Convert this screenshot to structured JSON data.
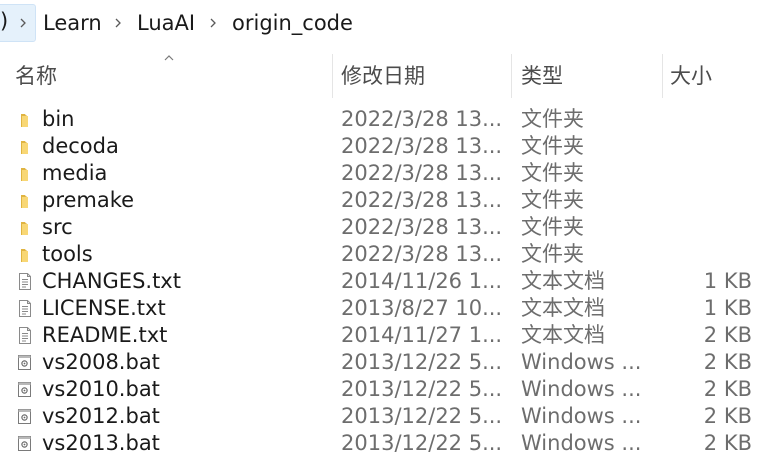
{
  "breadcrumb": {
    "partial_left": ")",
    "items": [
      "Learn",
      "LuaAI",
      "origin_code"
    ]
  },
  "columns": {
    "name": "名称",
    "date": "修改日期",
    "type": "类型",
    "size": "大小"
  },
  "files": [
    {
      "name": "bin",
      "date": "2022/3/28 13...",
      "type": "文件夹",
      "size": "",
      "icon": "folder-icon"
    },
    {
      "name": "decoda",
      "date": "2022/3/28 13...",
      "type": "文件夹",
      "size": "",
      "icon": "folder-icon"
    },
    {
      "name": "media",
      "date": "2022/3/28 13...",
      "type": "文件夹",
      "size": "",
      "icon": "folder-icon"
    },
    {
      "name": "premake",
      "date": "2022/3/28 13...",
      "type": "文件夹",
      "size": "",
      "icon": "folder-icon"
    },
    {
      "name": "src",
      "date": "2022/3/28 13...",
      "type": "文件夹",
      "size": "",
      "icon": "folder-icon"
    },
    {
      "name": "tools",
      "date": "2022/3/28 13...",
      "type": "文件夹",
      "size": "",
      "icon": "folder-icon"
    },
    {
      "name": "CHANGES.txt",
      "date": "2014/11/26 1...",
      "type": "文本文档",
      "size": "1 KB",
      "icon": "text-file-icon"
    },
    {
      "name": "LICENSE.txt",
      "date": "2013/8/27 10...",
      "type": "文本文档",
      "size": "1 KB",
      "icon": "text-file-icon"
    },
    {
      "name": "README.txt",
      "date": "2014/11/27 1...",
      "type": "文本文档",
      "size": "2 KB",
      "icon": "text-file-icon"
    },
    {
      "name": "vs2008.bat",
      "date": "2013/12/22 5...",
      "type": "Windows ...",
      "size": "2 KB",
      "icon": "batch-file-icon"
    },
    {
      "name": "vs2010.bat",
      "date": "2013/12/22 5...",
      "type": "Windows ...",
      "size": "2 KB",
      "icon": "batch-file-icon"
    },
    {
      "name": "vs2012.bat",
      "date": "2013/12/22 5...",
      "type": "Windows ...",
      "size": "2 KB",
      "icon": "batch-file-icon"
    },
    {
      "name": "vs2013.bat",
      "date": "2013/12/22 5...",
      "type": "Windows ...",
      "size": "2 KB",
      "icon": "batch-file-icon"
    }
  ],
  "colors": {
    "folder": "#f8d775",
    "folder_dark": "#e0b441",
    "header_text": "#4c4c4c",
    "secondary_text": "#6d6d6d",
    "address_highlight": "#e5f1fb"
  }
}
